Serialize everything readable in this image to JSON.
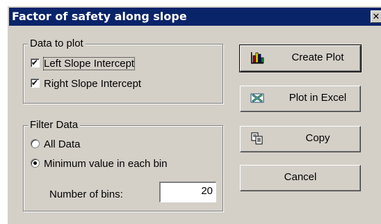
{
  "window": {
    "title": "Factor of safety along slope",
    "close_glyph": "✕"
  },
  "data_to_plot": {
    "title": "Data to plot",
    "left_label": "Left Slope Intercept",
    "left_checked": true,
    "right_label": "Right Slope Intercept",
    "right_checked": true
  },
  "filter_data": {
    "title": "Filter Data",
    "all_label": "All Data",
    "min_label": "Minimum value in each bin",
    "selected": "min",
    "bins_label": "Number of bins:",
    "bins_value": "20"
  },
  "buttons": {
    "create_plot": {
      "label": "Create Plot",
      "icon": "bar-chart-icon"
    },
    "plot_excel": {
      "label": "Plot in Excel",
      "icon": "excel-icon"
    },
    "copy": {
      "label": "Copy",
      "icon": "copy-icon"
    },
    "cancel": {
      "label": "Cancel"
    }
  }
}
